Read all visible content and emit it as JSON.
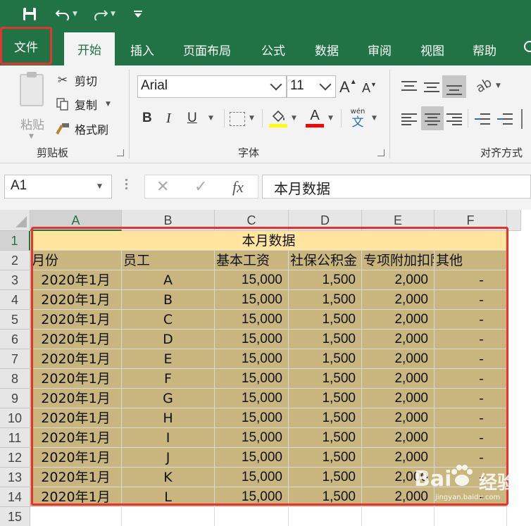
{
  "ribbon_tabs": {
    "file": "文件",
    "items": [
      "开始",
      "插入",
      "页面布局",
      "公式",
      "数据",
      "审阅",
      "视图",
      "帮助"
    ],
    "active_index": 0
  },
  "clipboard": {
    "paste": "粘贴",
    "cut": "剪切",
    "copy": "复制",
    "format_painter": "格式刷",
    "group_label": "剪贴板"
  },
  "font": {
    "name": "Arial",
    "size": "11",
    "bold": "B",
    "italic": "I",
    "underline": "U",
    "phonetic_top": "wén",
    "phonetic_bottom": "文",
    "group_label": "字体",
    "highlight_color": "#ffff00",
    "font_color": "#ff0000"
  },
  "alignment": {
    "group_label": "对齐方式"
  },
  "formula_bar": {
    "name_box": "A1",
    "fx": "fx",
    "content": "本月数据"
  },
  "sheet": {
    "columns": [
      "A",
      "B",
      "C",
      "D",
      "E",
      "F"
    ],
    "row_numbers": [
      "1",
      "2",
      "3",
      "4",
      "5",
      "6",
      "7",
      "8",
      "9",
      "10",
      "11",
      "12",
      "13",
      "14",
      "15"
    ],
    "title": "本月数据",
    "headers": [
      "月份",
      "员工",
      "基本工资",
      "社保公积金",
      "专项附加扣除",
      "其他"
    ],
    "rows": [
      [
        "2020年1月",
        "A",
        "15,000",
        "1,500",
        "2,000",
        "-"
      ],
      [
        "2020年1月",
        "B",
        "15,000",
        "1,500",
        "2,000",
        "-"
      ],
      [
        "2020年1月",
        "C",
        "15,000",
        "1,500",
        "2,000",
        "-"
      ],
      [
        "2020年1月",
        "D",
        "15,000",
        "1,500",
        "2,000",
        "-"
      ],
      [
        "2020年1月",
        "E",
        "15,000",
        "1,500",
        "2,000",
        "-"
      ],
      [
        "2020年1月",
        "F",
        "15,000",
        "1,500",
        "2,000",
        "-"
      ],
      [
        "2020年1月",
        "G",
        "15,000",
        "1,500",
        "2,000",
        "-"
      ],
      [
        "2020年1月",
        "H",
        "15,000",
        "1,500",
        "2,000",
        "-"
      ],
      [
        "2020年1月",
        "I",
        "15,000",
        "1,500",
        "2,000",
        "-"
      ],
      [
        "2020年1月",
        "J",
        "15,000",
        "1,500",
        "2,000",
        "-"
      ],
      [
        "2020年1月",
        "K",
        "15,000",
        "1,500",
        "2,000",
        "-"
      ],
      [
        "2020年1月",
        "L",
        "15,000",
        "1,500",
        "2,000",
        "-"
      ]
    ]
  },
  "watermark": {
    "brand": "Bai",
    "suffix": "经验",
    "url": "jingyan.baidu.com"
  },
  "colors": {
    "excel_green": "#217346",
    "title_fill": "#ffe59e",
    "data_fill": "#c9b57e",
    "highlight_frame": "#e8322d"
  }
}
